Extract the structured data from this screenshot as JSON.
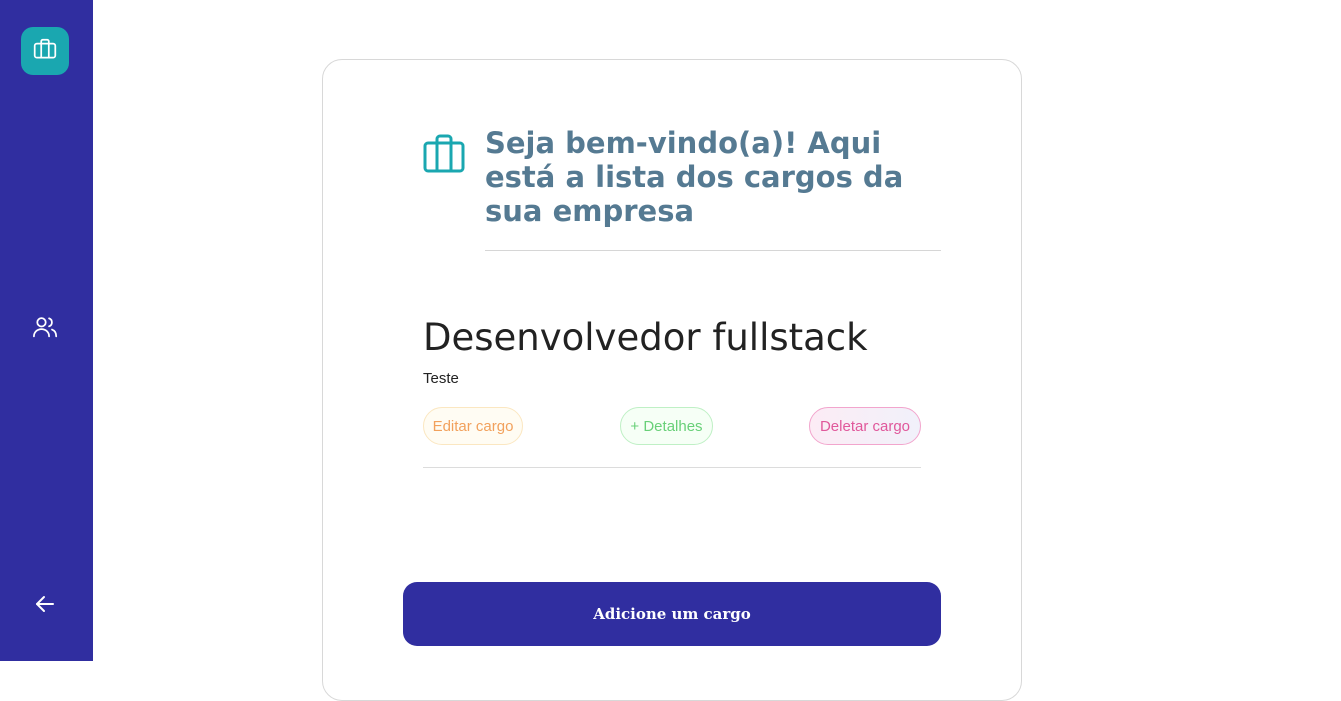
{
  "sidebar": {
    "items": [
      {
        "icon": "briefcase-icon",
        "active": true
      },
      {
        "icon": "users-icon",
        "active": false
      },
      {
        "icon": "arrow-left-icon",
        "active": false
      }
    ]
  },
  "main": {
    "title": "Seja bem-vindo(a)! Aqui está a lista dos cargos da sua empresa",
    "header_icon": "briefcase-icon",
    "jobs": [
      {
        "title": "Desenvolvedor fullstack",
        "description": "Teste",
        "actions": {
          "edit": "Editar cargo",
          "details": "+ Detalhes",
          "delete": "Deletar cargo"
        }
      }
    ],
    "add_button": "Adicione um cargo"
  },
  "colors": {
    "sidebar": "#302ea0",
    "accent": "#1aa7b0",
    "title": "#557a92",
    "edit": "#f2a15c",
    "details": "#68d078",
    "delete": "#e0589b"
  }
}
